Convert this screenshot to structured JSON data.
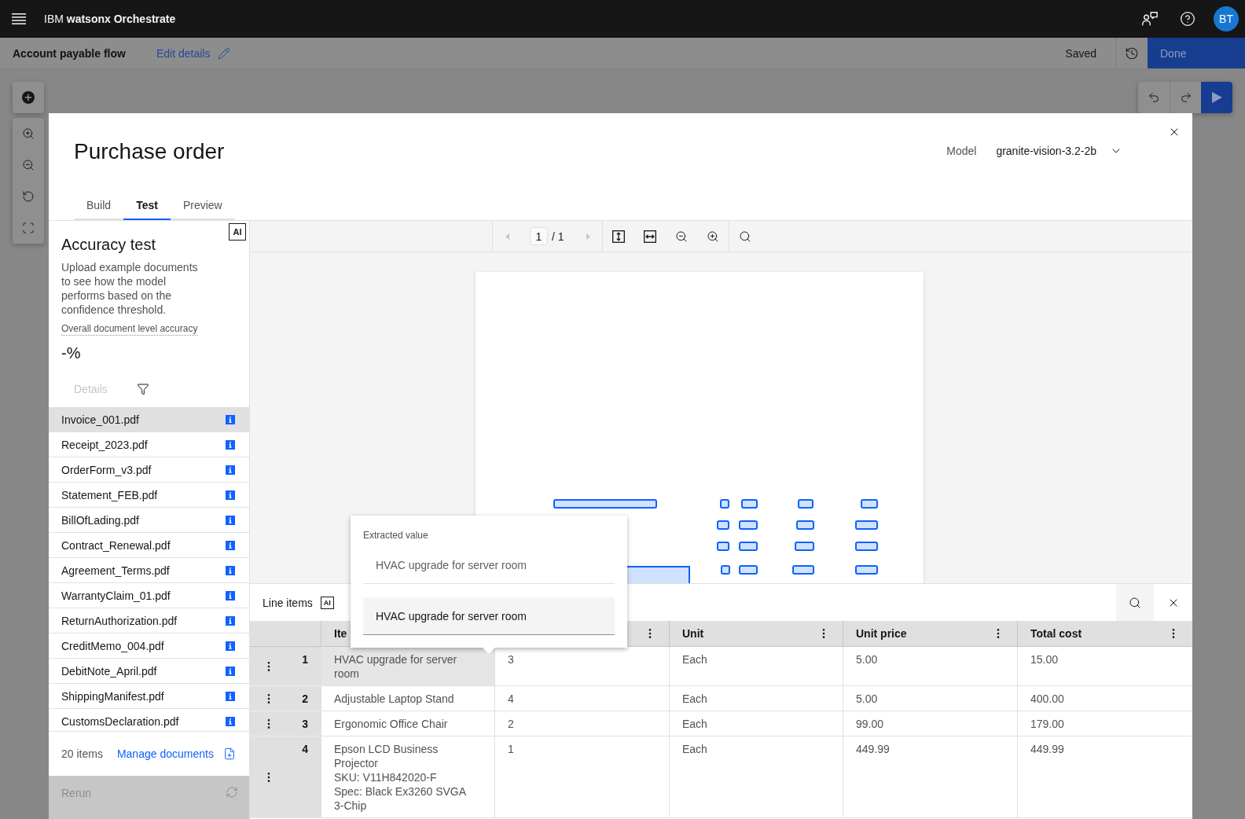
{
  "top_bar": {
    "brand": "IBM **watsonx Orchestrate**",
    "avatar_initials": "BT"
  },
  "flow_bar": {
    "title": "Account payable flow",
    "edit_link": "Edit details",
    "status": "Saved",
    "done_button": "Done"
  },
  "modal": {
    "title": "Purchase order",
    "model_label": "Model",
    "model_value": "granite-vision-3.2-2b",
    "tabs": [
      {
        "label": "Build",
        "selected": false
      },
      {
        "label": "Test",
        "selected": true
      },
      {
        "label": "Preview",
        "selected": false
      }
    ]
  },
  "accuracy_panel": {
    "badge": "AI",
    "title": "Accuracy test",
    "description": "Upload example documents to see how the model performs based on the confidence threshold.",
    "metric_label": "Overall document level accuracy",
    "metric_value": "-%",
    "details_tab": {
      "label": "Details",
      "disabled": true
    },
    "documents": [
      {
        "name": "Invoice_001.pdf",
        "selected": true
      },
      {
        "name": "Receipt_2023.pdf",
        "selected": false
      },
      {
        "name": "OrderForm_v3.pdf",
        "selected": false
      },
      {
        "name": "Statement_FEB.pdf",
        "selected": false
      },
      {
        "name": "BillOfLading.pdf",
        "selected": false
      },
      {
        "name": "Contract_Renewal.pdf",
        "selected": false
      },
      {
        "name": "Agreement_Terms.pdf",
        "selected": false
      },
      {
        "name": "WarrantyClaim_01.pdf",
        "selected": false
      },
      {
        "name": "ReturnAuthorization.pdf",
        "selected": false
      },
      {
        "name": "CreditMemo_004.pdf",
        "selected": false
      },
      {
        "name": "DebitNote_April.pdf",
        "selected": false
      },
      {
        "name": "ShippingManifest.pdf",
        "selected": false
      },
      {
        "name": "CustomsDeclaration.pdf",
        "selected": false
      }
    ],
    "count": "20 items",
    "manage_link": "Manage documents",
    "rerun_button": {
      "label": "Rerun",
      "disabled": true
    }
  },
  "viewer": {
    "page_value": "1",
    "page_total": "/ 1",
    "previous_disabled": true,
    "next_disabled": true
  },
  "line_items": {
    "title": "Line items",
    "badge": "AI",
    "columns": [
      {
        "label": "Ite",
        "menu": false
      },
      {
        "menu": true
      },
      {
        "label": "Unit",
        "menu": true
      },
      {
        "label": "Unit price",
        "menu": true
      },
      {
        "label": "Total cost",
        "menu": true
      }
    ],
    "rows": [
      {
        "number": "1",
        "item": "HVAC upgrade for server room",
        "quantity": "3",
        "unit": "Each",
        "unit_price": "5.00",
        "total_cost": "15.00",
        "selected": true
      },
      {
        "number": "2",
        "item": "Adjustable Laptop Stand",
        "quantity": "4",
        "unit": "Each",
        "unit_price": "5.00",
        "total_cost": "400.00",
        "selected": false
      },
      {
        "number": "3",
        "item": "Ergonomic Office Chair",
        "quantity": "2",
        "unit": "Each",
        "unit_price": "99.00",
        "total_cost": "179.00",
        "selected": false
      },
      {
        "number": "4",
        "item": "Epson LCD Business Projector\nSKU: V11H842020-F\nSpec: Black Ex3260 SVGA 3-Chip",
        "quantity": "1",
        "unit": "Each",
        "unit_price": "449.99",
        "total_cost": "449.99",
        "selected": false
      }
    ]
  },
  "popover": {
    "label": "Extracted value",
    "extracted_value": "HVAC upgrade for server room",
    "input_value": "HVAC upgrade for server room"
  }
}
